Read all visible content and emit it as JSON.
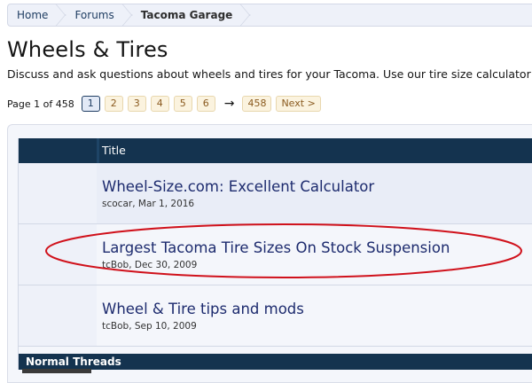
{
  "breadcrumb": {
    "items": [
      {
        "label": "Home"
      },
      {
        "label": "Forums"
      },
      {
        "label": "Tacoma Garage"
      }
    ]
  },
  "page": {
    "title": "Wheels & Tires",
    "description": "Discuss and ask questions about wheels and tires for your Tacoma. Use our tire size calculator"
  },
  "pagination": {
    "label": "Page 1 of 458",
    "pages": [
      "1",
      "2",
      "3",
      "4",
      "5",
      "6"
    ],
    "arrow": "→",
    "last": "458",
    "next": "Next >"
  },
  "thread_list": {
    "column_title": "Title",
    "sticky_threads": [
      {
        "title": "Wheel-Size.com: Excellent Calculator",
        "author": "scocar",
        "date": "Mar 1, 2016"
      },
      {
        "title": "Largest Tacoma Tire Sizes On Stock Suspension",
        "author": "tcBob",
        "date": "Dec 30, 2009"
      },
      {
        "title": "Wheel & Tire tips and mods",
        "author": "tcBob",
        "date": "Sep 10, 2009"
      }
    ],
    "normal_section_label": "Normal Threads"
  },
  "annotation": {
    "highlight_color": "#d0111b"
  }
}
